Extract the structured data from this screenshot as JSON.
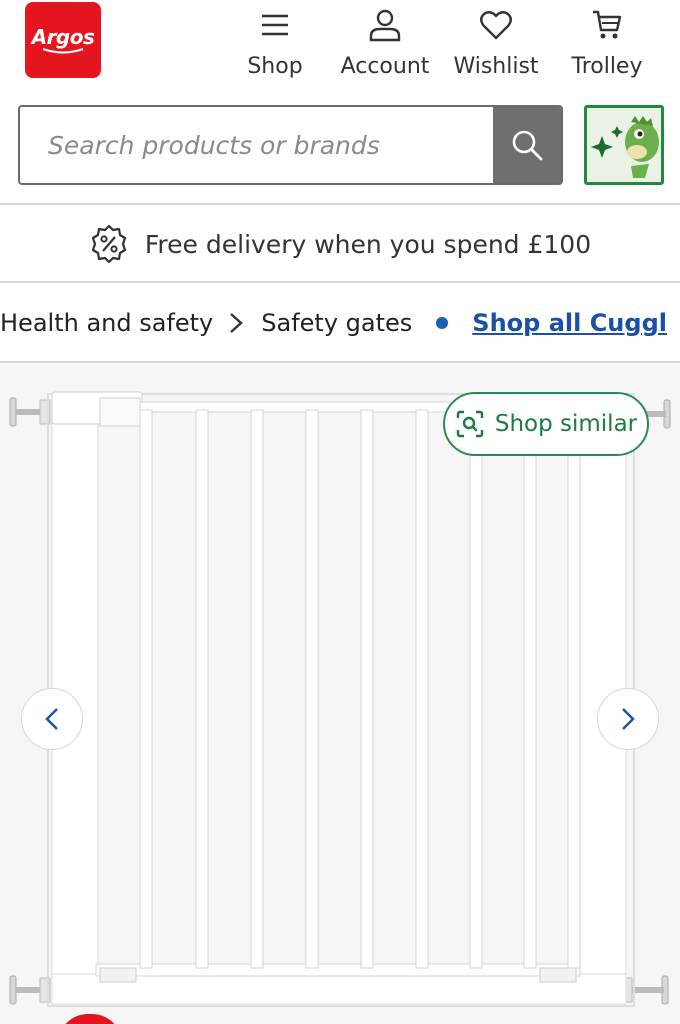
{
  "brand": {
    "logo_text": "Argos",
    "color": "#e4151f"
  },
  "nav": {
    "shop": {
      "label": "Shop",
      "icon": "menu-icon"
    },
    "account": {
      "label": "Account",
      "icon": "user-icon"
    },
    "wishlist": {
      "label": "Wishlist",
      "icon": "heart-icon"
    },
    "trolley": {
      "label": "Trolley",
      "icon": "trolley-icon"
    }
  },
  "search": {
    "placeholder": "Search products or brands",
    "value": "",
    "button_icon": "search-icon"
  },
  "promo_tile": {
    "icon": "dinosaur-sparkle-icon",
    "accent": "#1e8a3c"
  },
  "delivery": {
    "icon": "percent-badge-icon",
    "text": "Free delivery when you spend £100"
  },
  "breadcrumb": {
    "items": [
      "Health and safety",
      "Safety gates"
    ],
    "shop_all": "Shop all Cuggl"
  },
  "product": {
    "image_icon": "safety-gate-image",
    "shop_similar_label": "Shop similar",
    "shop_similar_icon": "visual-search-icon",
    "prev_icon": "chevron-left-icon",
    "next_icon": "chevron-right-icon"
  },
  "colors": {
    "accent_green": "#1e7a3e",
    "link_blue": "#1b4fa8",
    "search_button": "#6f6f6f"
  }
}
